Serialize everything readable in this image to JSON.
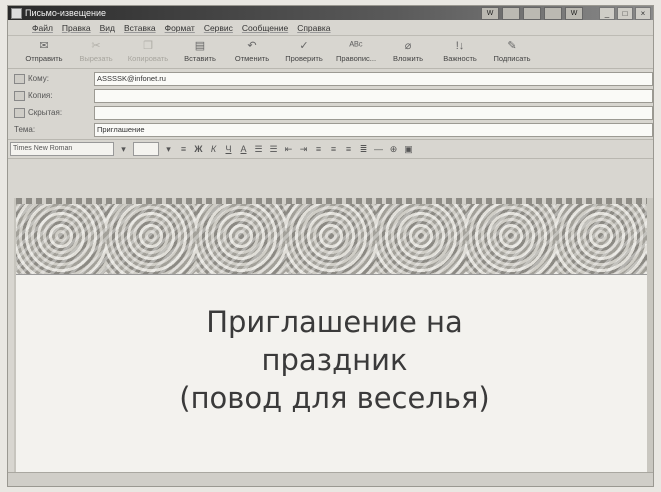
{
  "window": {
    "title": "Письмо-извещение"
  },
  "titlebar": {
    "buttons": [
      "_",
      "□",
      "×"
    ],
    "tray": [
      "W",
      "",
      "",
      "",
      "W"
    ]
  },
  "menu": [
    "Файл",
    "Правка",
    "Вид",
    "Вставка",
    "Формат",
    "Сервис",
    "Сообщение",
    "Справка"
  ],
  "toolbar": [
    {
      "label": "Отправить",
      "icon": "send-icon",
      "enabled": true
    },
    {
      "label": "Вырезать",
      "icon": "cut-icon",
      "enabled": false
    },
    {
      "label": "Копировать",
      "icon": "copy-icon",
      "enabled": false
    },
    {
      "label": "Вставить",
      "icon": "paste-icon",
      "enabled": true
    },
    {
      "label": "Отменить",
      "icon": "undo-icon",
      "enabled": true
    },
    {
      "label": "Проверить",
      "icon": "check-names-icon",
      "enabled": true
    },
    {
      "label": "Правопис...",
      "icon": "spelling-icon",
      "enabled": true
    },
    {
      "label": "Вложить",
      "icon": "attach-icon",
      "enabled": true
    },
    {
      "label": "Важность",
      "icon": "priority-icon",
      "enabled": true
    },
    {
      "label": "Подписать",
      "icon": "sign-icon",
      "enabled": true
    }
  ],
  "fields": {
    "to_label": "Кому:",
    "to_value": "ASSSSK@infonet.ru",
    "cc_label": "Копия:",
    "cc_value": "",
    "bcc_label": "Скрытая:",
    "bcc_value": "",
    "subject_label": "Тема:",
    "subject_value": "Приглашение"
  },
  "format": {
    "font": "Times New Roman",
    "size": ""
  },
  "message": {
    "line1": "Приглашение на",
    "line2": "праздник",
    "line3": "(повод для веселья)"
  }
}
